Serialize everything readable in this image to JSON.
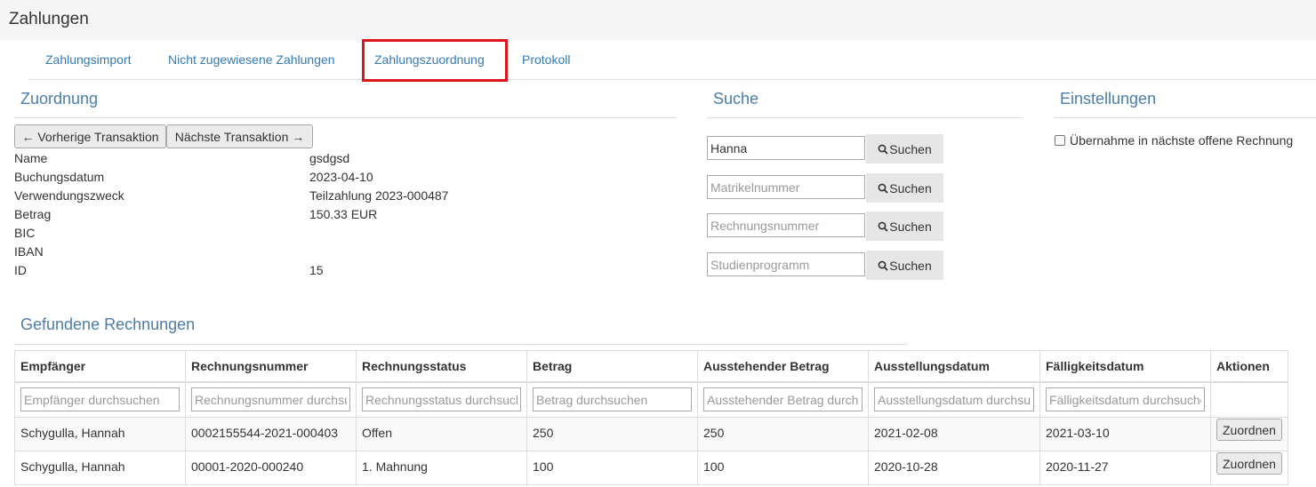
{
  "page": {
    "title": "Zahlungen"
  },
  "tabs": [
    {
      "label": "Zahlungsimport"
    },
    {
      "label": "Nicht zugewiesene Zahlungen"
    },
    {
      "label": "Zahlungszuordnung"
    },
    {
      "label": "Protokoll"
    }
  ],
  "colors": {
    "link": "#337ab7",
    "heading": "#4a7dae",
    "highlight": "#e0141e"
  },
  "assignment": {
    "heading": "Zuordnung",
    "prev_label": "← Vorherige Transaktion",
    "next_label": "Nächste Transaktion →",
    "details": [
      {
        "label": "Name",
        "value": "gsdgsd"
      },
      {
        "label": "Buchungsdatum",
        "value": "2023-04-10"
      },
      {
        "label": "Verwendungszweck",
        "value": "Teilzahlung 2023-000487"
      },
      {
        "label": "Betrag",
        "value": "150.33 EUR"
      },
      {
        "label": "BIC",
        "value": ""
      },
      {
        "label": "IBAN",
        "value": ""
      },
      {
        "label": "ID",
        "value": "15"
      }
    ]
  },
  "search": {
    "heading": "Suche",
    "button_label": "Suchen",
    "fields": [
      {
        "value": "Hanna",
        "placeholder": ""
      },
      {
        "value": "",
        "placeholder": "Matrikelnummer"
      },
      {
        "value": "",
        "placeholder": "Rechnungsnummer"
      },
      {
        "value": "",
        "placeholder": "Studienprogramm"
      }
    ]
  },
  "settings": {
    "heading": "Einstellungen",
    "checkbox_label": "Übernahme in nächste offene Rechnung",
    "checkbox_checked": false
  },
  "invoices": {
    "heading": "Gefundene Rechnungen",
    "columns": [
      "Empfänger",
      "Rechnungsnummer",
      "Rechnungsstatus",
      "Betrag",
      "Ausstehender Betrag",
      "Ausstellungsdatum",
      "Fälligkeitsdatum",
      "Aktionen"
    ],
    "filter_placeholders": [
      "Empfänger durchsuchen",
      "Rechnungsnummer durchsuchen",
      "Rechnungsstatus durchsuchen",
      "Betrag durchsuchen",
      "Ausstehender Betrag durchsuchen",
      "Ausstellungsdatum durchsuchen",
      "Fälligkeitsdatum durchsuchen"
    ],
    "action_label": "Zuordnen",
    "rows": [
      [
        "Schygulla, Hannah",
        "0002155544-2021-000403",
        "Offen",
        "250",
        "250",
        "2021-02-08",
        "2021-03-10"
      ],
      [
        "Schygulla, Hannah",
        "00001-2020-000240",
        "1. Mahnung",
        "100",
        "100",
        "2020-10-28",
        "2020-11-27"
      ]
    ]
  }
}
